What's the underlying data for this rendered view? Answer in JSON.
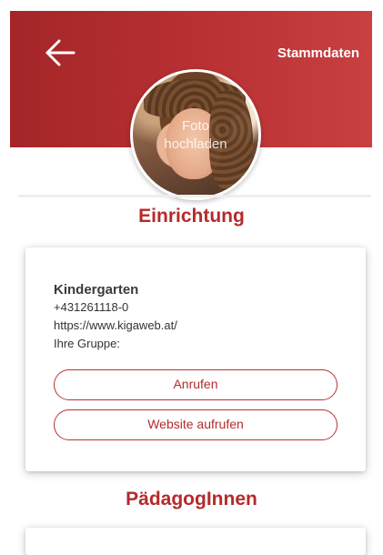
{
  "header": {
    "title": "Stammdaten",
    "back_icon": "arrow-left-icon"
  },
  "avatar": {
    "upload_label_line1": "Foto",
    "upload_label_line2": "hochladen"
  },
  "sections": {
    "facility_title": "Einrichtung",
    "educators_title": "PädagogInnen"
  },
  "facility": {
    "name": "Kindergarten",
    "phone": "+431261118-0",
    "website": "https://www.kigaweb.at/",
    "group_label": "Ihre Gruppe:"
  },
  "buttons": {
    "call_label": "Anrufen",
    "website_label": "Website aufrufen"
  },
  "colors": {
    "brand": "#b52a2b",
    "header_start": "#a42628",
    "header_end": "#c84040"
  }
}
